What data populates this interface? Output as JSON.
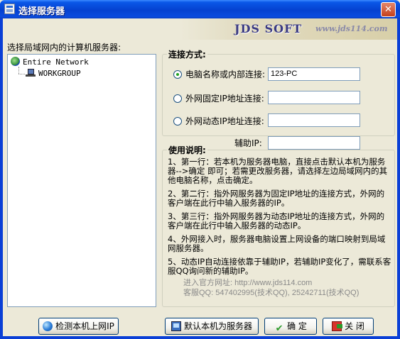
{
  "window": {
    "title": "选择服务器",
    "close_glyph": "✕"
  },
  "banner": {
    "logo": "JDS SOFT",
    "url": "www.jds114.com"
  },
  "left_panel": {
    "label": "选择局域网内的计算机服务器:",
    "tree": {
      "root": "Entire Network",
      "children": [
        "WORKGROUP"
      ]
    }
  },
  "connection": {
    "legend": "连接方式:",
    "options": [
      {
        "label": "电脑名称或内部连接:",
        "value": "123-PC",
        "selected": true
      },
      {
        "label": "外网固定IP地址连接:",
        "value": "",
        "selected": false
      },
      {
        "label": "外网动态IP地址连接:",
        "value": "",
        "selected": false
      }
    ],
    "aux_ip_label": "辅助IP:",
    "aux_ip_value": ""
  },
  "help": {
    "legend": "使用说明:",
    "items": [
      "1、第一行：若本机为服务器电脑，直接点击默认本机为服务器-->确定 即可；若需更改服务器，请选择左边局域网内的其他电脑名称，点击确定。",
      "2、第二行：指外网服务器为固定IP地址的连接方式，外网的客户端在此行中输入服务器的IP。",
      "3、第三行：指外网服务器为动态IP地址的连接方式，外网的客户端在此行中输入服务器的动态IP。",
      "4、外网接入时，服务器电脑设置上网设备的端口映射到局域网服务器。",
      "5、动态IP自动连接依靠于辅助IP，若辅助IP变化了，需联系客服QQ询问新的辅助IP。"
    ],
    "website": "进入官方网址: http://www.jds114.com",
    "support": "客服QQ: 547402995(技术QQ), 25242711(技术QQ)"
  },
  "buttons": {
    "detect": "检测本机上网IP",
    "default_server": "默认本机为服务器",
    "ok": "确 定",
    "close": "关 闭"
  },
  "icons": {
    "check_glyph": "✔"
  }
}
